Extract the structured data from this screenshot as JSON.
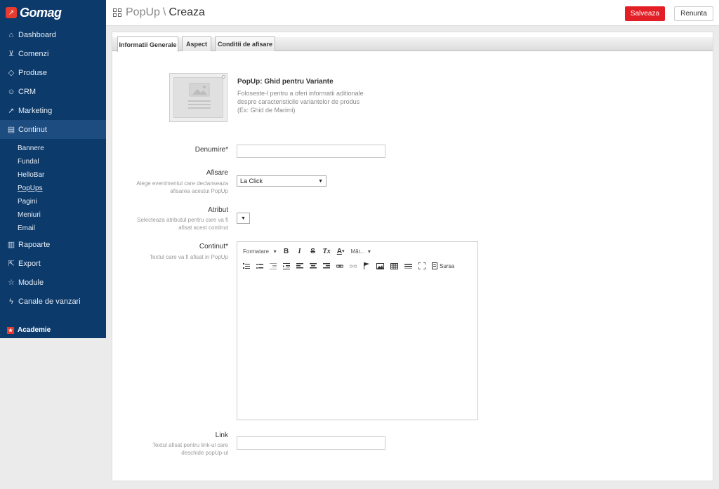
{
  "app": {
    "logo_text": "Gomag"
  },
  "sidebar": {
    "items": [
      {
        "label": "Dashboard",
        "icon": "home-icon"
      },
      {
        "label": "Comenzi",
        "icon": "cart-icon"
      },
      {
        "label": "Produse",
        "icon": "tag-icon"
      },
      {
        "label": "CRM",
        "icon": "users-icon"
      },
      {
        "label": "Marketing",
        "icon": "rocket-icon"
      },
      {
        "label": "Continut",
        "icon": "book-icon"
      }
    ],
    "sub_items": [
      "Bannere",
      "Fundal",
      "HelloBar",
      "PopUps",
      "Pagini",
      "Meniuri",
      "Email"
    ],
    "items_after": [
      {
        "label": "Rapoarte",
        "icon": "chart-icon"
      },
      {
        "label": "Export",
        "icon": "export-icon"
      },
      {
        "label": "Module",
        "icon": "star-icon"
      },
      {
        "label": "Canale de vanzari",
        "icon": "plug-icon"
      }
    ],
    "academie": "Academie"
  },
  "header": {
    "crumb": "PopUp",
    "separator": "\\",
    "title": "Creaza",
    "save_label": "Salveaza",
    "cancel_label": "Renunta"
  },
  "tabs": [
    "Informatii Generale",
    "Aspect",
    "Conditii de afisare"
  ],
  "popup_info": {
    "title": "PopUp: Ghid pentru Variante",
    "desc_line1": "Foloseste-l pentru a oferi informatii aditionale",
    "desc_line2": "despre caracteristicile variantelor de produs",
    "desc_line3": "(Ex: Ghid de Marimi)"
  },
  "form": {
    "denumire_label": "Denumire*",
    "denumire_value": "",
    "afisare_label": "Afisare",
    "afisare_help1": "Alege evenimentul care declanseaza",
    "afisare_help2": "afisarea acestui PopUp",
    "afisare_value": "La Click",
    "atribut_label": "Atribut",
    "atribut_help1": "Selecteaza atributul pentru care va fi",
    "atribut_help2": "afisat acest continut",
    "atribut_value": "",
    "continut_label": "Continut*",
    "continut_help": "Textul care va fi afisat in PopUp",
    "link_label": "Link",
    "link_help1": "Textul afisat pentru link-ul care",
    "link_help2": "deschide popUp-ul",
    "link_value": ""
  },
  "editor": {
    "format_label": "Formatare",
    "size_label": "Măr...",
    "bold": "B",
    "italic": "I",
    "strike": "S",
    "clear": "Tx",
    "color": "A",
    "source_label": "Sursa"
  }
}
